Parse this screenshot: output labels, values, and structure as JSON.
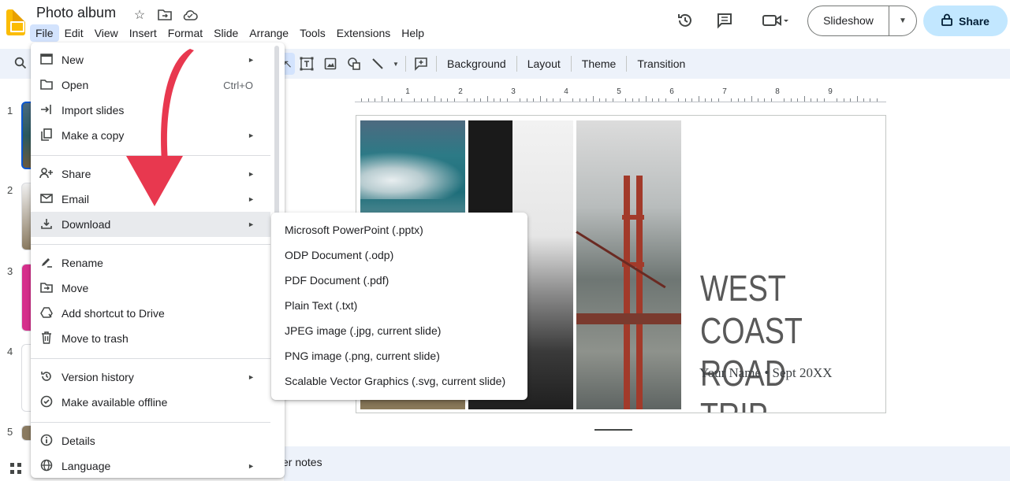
{
  "app": {
    "title": "Photo album"
  },
  "menubar": [
    "File",
    "Edit",
    "View",
    "Insert",
    "Format",
    "Slide",
    "Arrange",
    "Tools",
    "Extensions",
    "Help"
  ],
  "header": {
    "slideshow_label": "Slideshow",
    "share_label": "Share"
  },
  "toolbar": {
    "background": "Background",
    "layout": "Layout",
    "theme": "Theme",
    "transition": "Transition"
  },
  "filmstrip": {
    "numbers": [
      "1",
      "2",
      "3",
      "4",
      "5"
    ]
  },
  "ruler": {
    "labels": [
      "1",
      "2",
      "3",
      "4",
      "5",
      "6",
      "7",
      "8",
      "9"
    ]
  },
  "slide": {
    "title_line1": "WEST COAST",
    "title_line2": "ROAD TRIP",
    "subtitle": "Your Name • Sept 20XX"
  },
  "notes": {
    "label": "er notes"
  },
  "file_menu": {
    "items": [
      {
        "label": "New",
        "icon": "new-presentation-icon",
        "arrow": true
      },
      {
        "label": "Open",
        "icon": "folder-icon",
        "shortcut": "Ctrl+O"
      },
      {
        "label": "Import slides",
        "icon": "import-icon"
      },
      {
        "label": "Make a copy",
        "icon": "copy-icon",
        "arrow": true
      },
      {
        "label": "Share",
        "icon": "share-person-icon",
        "arrow": true
      },
      {
        "label": "Email",
        "icon": "email-icon",
        "arrow": true
      },
      {
        "label": "Download",
        "icon": "download-icon",
        "arrow": true
      },
      {
        "label": "Rename",
        "icon": "rename-icon"
      },
      {
        "label": "Move",
        "icon": "move-folder-icon"
      },
      {
        "label": "Add shortcut to Drive",
        "icon": "drive-shortcut-icon"
      },
      {
        "label": "Move to trash",
        "icon": "trash-icon"
      },
      {
        "label": "Version history",
        "icon": "history-icon",
        "arrow": true
      },
      {
        "label": "Make available offline",
        "icon": "offline-icon"
      },
      {
        "label": "Details",
        "icon": "info-icon"
      },
      {
        "label": "Language",
        "icon": "globe-icon",
        "arrow": true
      }
    ]
  },
  "download_submenu": {
    "items": [
      "Microsoft PowerPoint (.pptx)",
      "ODP Document (.odp)",
      "PDF Document (.pdf)",
      "Plain Text (.txt)",
      "JPEG image (.jpg, current slide)",
      "PNG image (.png, current slide)",
      "Scalable Vector Graphics (.svg, current slide)"
    ]
  },
  "colors": {
    "accent": "#c2e7ff",
    "arrow": "#e8384f",
    "toolbar_bg": "#edf2fa",
    "menu_highlight": "#e8eaed"
  }
}
